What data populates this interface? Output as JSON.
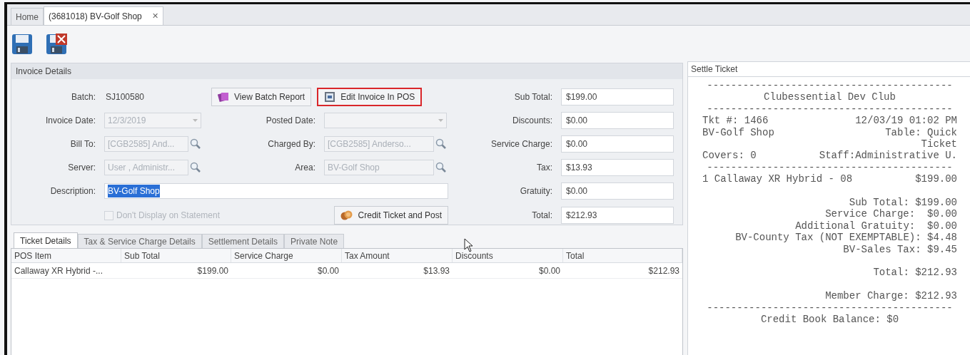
{
  "tabs": [
    {
      "label": "Home",
      "selected": false
    },
    {
      "label": "(3681018) BV-Golf Shop",
      "selected": true,
      "close_glyph": "✕"
    }
  ],
  "toolbar": [
    {
      "kind": "save"
    },
    {
      "kind": "save_close"
    }
  ],
  "invoice_details": {
    "title": "Invoice Details",
    "rows": [
      {
        "left": {
          "kind": "plain",
          "label": "Batch:",
          "value": "SJ100580"
        },
        "middle": {
          "kind": "buttons",
          "buttons": [
            {
              "label": "View Batch Report",
              "highlighted": false
            },
            {
              "label": "Edit Invoice In POS",
              "highlighted": true
            }
          ]
        },
        "right": {
          "label": "Sub Total:",
          "value": "$199.00"
        }
      },
      {
        "left": {
          "kind": "dropdown",
          "label": "Invoice Date:",
          "value": "12/3/2019",
          "disabled": true
        },
        "middle": {
          "kind": "dropdown",
          "label": "Posted Date:",
          "disabled": true
        },
        "right": {
          "label": "Discounts:",
          "value": "$0.00"
        }
      },
      {
        "left": {
          "kind": "lookup",
          "label": "Bill To:",
          "value": "[CGB2585] And...",
          "disabled": true
        },
        "middle": {
          "kind": "lookup",
          "label": "Charged By:",
          "value": "[CGB2585] Anderso...",
          "disabled": true
        },
        "right": {
          "label": "Service Charge:",
          "value": "$0.00"
        }
      },
      {
        "left": {
          "kind": "lookup",
          "label": "Server:",
          "value": "User , Administr...",
          "disabled": true
        },
        "middle": {
          "kind": "lookup",
          "label": "Area:",
          "value": "BV-Golf Shop",
          "disabled": true
        },
        "right": {
          "label": "Tax:",
          "value": "$13.93"
        }
      },
      {
        "left": {
          "kind": "input",
          "label": "Description:",
          "value": "BV-Golf Shop",
          "text_selected": true
        },
        "right": {
          "label": "Gratuity:",
          "value": "$0.00"
        }
      },
      {
        "left": {
          "kind": "checkbox",
          "label": "Don't Display on Statement",
          "checked": false,
          "disabled": true
        },
        "middle": {
          "kind": "buttons",
          "buttons": [
            {
              "label": "Credit Ticket and Post",
              "highlighted": false
            }
          ]
        },
        "right": {
          "label": "Total:",
          "value": "$212.93"
        }
      }
    ]
  },
  "detail_tabs": [
    {
      "label": "Ticket Details",
      "selected": true
    },
    {
      "label": "Tax & Service Charge Details",
      "selected": false
    },
    {
      "label": "Settlement Details",
      "selected": false
    },
    {
      "label": "Private Note",
      "selected": false
    }
  ],
  "table": {
    "columns": [
      "POS Item",
      "Sub Total",
      "Service Charge",
      "Tax Amount",
      "Discounts",
      "Total"
    ],
    "rows": [
      [
        "Callaway XR Hybrid -...",
        "$199.00",
        "$0.00",
        "$13.93",
        "$0.00",
        "$212.93"
      ]
    ]
  },
  "settle_ticket": {
    "title": "Settle Ticket",
    "lines": [
      {
        "kind": "center",
        "text": "-----------------------------------------"
      },
      {
        "kind": "center",
        "text": "Clubessential Dev Club"
      },
      {
        "kind": "center",
        "text": "-----------------------------------------"
      },
      {
        "kind": "split",
        "left": "Tkt #: 1466",
        "right": "12/03/19 01:02 PM"
      },
      {
        "kind": "split",
        "left": "BV-Golf Shop",
        "right": "Table: Quick"
      },
      {
        "kind": "right",
        "text": "Ticket"
      },
      {
        "kind": "split",
        "left": "Covers: 0",
        "right": "Staff:Administrative U."
      },
      {
        "kind": "center",
        "text": "-----------------------------------------"
      },
      {
        "kind": "split",
        "left": "1 Callaway XR Hybrid - 08",
        "right": "$199.00"
      },
      {
        "kind": "gap"
      },
      {
        "kind": "right",
        "text": "Sub Total: $199.00"
      },
      {
        "kind": "right",
        "text": "Service Charge:  $0.00"
      },
      {
        "kind": "right",
        "text": "Additional Gratuity:  $0.00"
      },
      {
        "kind": "right",
        "text": "BV-County Tax (NOT EXEMPTABLE): $4.48"
      },
      {
        "kind": "right",
        "text": "BV-Sales Tax: $9.45"
      },
      {
        "kind": "gap"
      },
      {
        "kind": "right",
        "text": "Total: $212.93"
      },
      {
        "kind": "gap"
      },
      {
        "kind": "right",
        "text": "Member Charge: $212.93"
      },
      {
        "kind": "center",
        "text": "-----------------------------------------"
      },
      {
        "kind": "center",
        "text": "Credit Book Balance: $0"
      }
    ]
  }
}
